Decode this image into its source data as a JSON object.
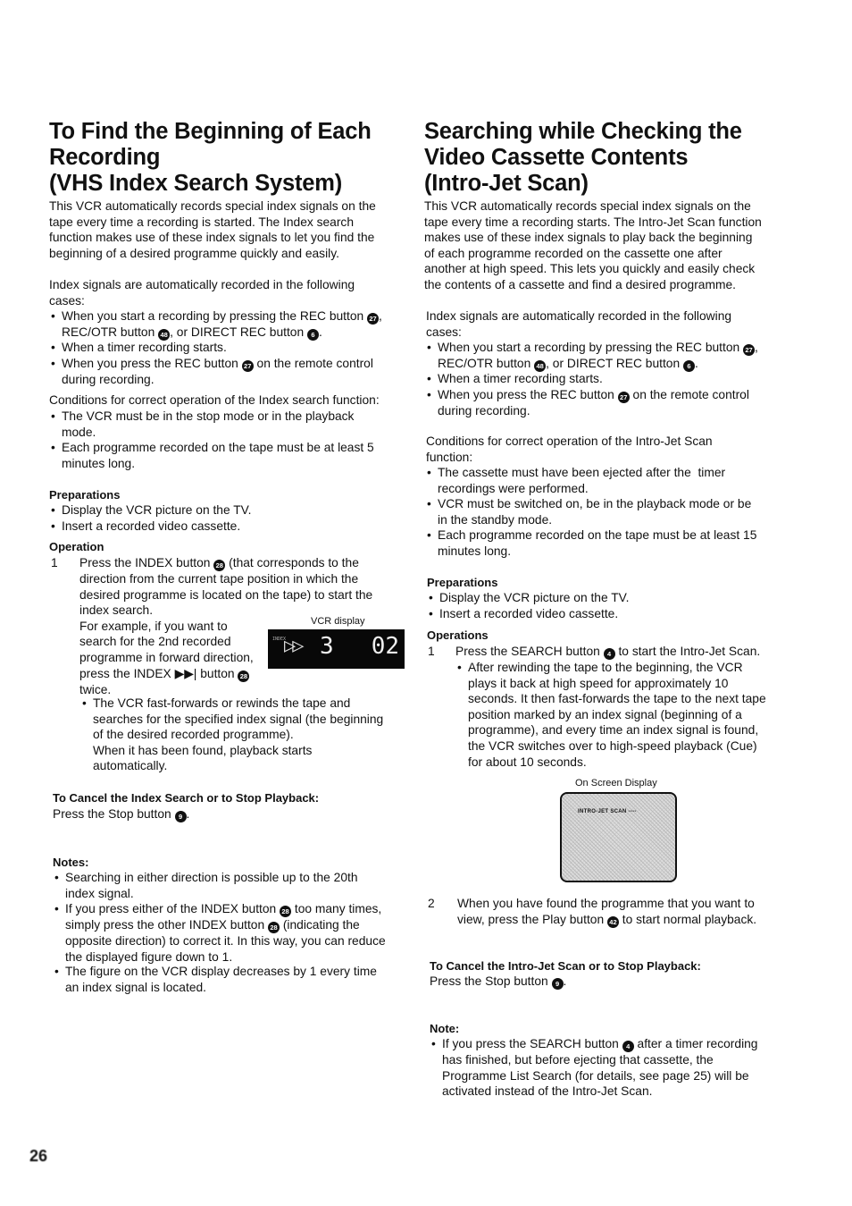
{
  "left": {
    "title": "To Find the Beginning of Each\nRecording\n(VHS Index Search System)",
    "intro": "This VCR automatically records special index signals on the\ntape every time a recording is started. The Index search\nfunction makes use of these index signals to let you find the\nbeginning of a desired programme quickly and easily.",
    "index_intro": "Index signals are automatically recorded in the following\ncases:",
    "index_cases": [
      "When you start a recording by pressing the REC button {27},\nREC/OTR button {48}, or DIRECT REC button {6}.",
      "When a timer recording starts.",
      "When you press the REC button {27} on the remote control\nduring recording."
    ],
    "conditions_intro": "Conditions for correct operation of the Index search function:",
    "conditions": [
      "The VCR must be in the stop mode or in the playback\nmode.",
      "Each programme recorded on the tape must be at least 5\nminutes long."
    ],
    "preparations_heading": "Preparations",
    "preparations": [
      "Display the VCR picture on the TV.",
      "Insert a recorded video cassette."
    ],
    "operation_heading": "Operation",
    "step1_num": "1",
    "step1_text": "Press the INDEX button {28} (that corresponds to the\ndirection from the current tape position in which the\ndesired programme is located on the tape) to start the\nindex search.\nFor example, if you want to\nsearch for the 2nd recorded\nprogramme in forward direction,\npress the INDEX ▶▶| button {28}\ntwice.",
    "vcr_display_label": "VCR display",
    "vcr_display": {
      "arrows": "▷▷",
      "left_digit": "3",
      "right_digits": "02",
      "tiny_label": "INDEX"
    },
    "step1_bullet": "The VCR fast-forwards or rewinds the tape and\nsearches for the specified index signal (the beginning\nof the desired recorded programme).\nWhen it has been found, playback starts\nautomatically.",
    "cancel_heading": "To Cancel the Index Search or to Stop Playback:",
    "cancel_text": "Press the Stop button {9}.",
    "notes_heading": "Notes:",
    "notes": [
      "Searching in either direction is possible up to the 20th\nindex signal.",
      "If you press either of the INDEX button {28} too many times,\nsimply press the other INDEX button {28} (indicating the\nopposite direction) to correct it. In this way, you can reduce\nthe displayed figure down to 1.",
      "The figure on the VCR display decreases by 1 every time\nan index signal is located."
    ]
  },
  "right": {
    "title": "Searching while Checking the\nVideo Cassette Contents\n(Intro-Jet Scan)",
    "intro": "This VCR automatically records special index signals on the\ntape every time a recording starts. The Intro-Jet Scan function\nmakes use of these index signals to play back the beginning\nof each programme recorded on the cassette one after\nanother at high speed. This lets you quickly and easily check\nthe contents of a cassette and find a desired programme.",
    "index_intro": "Index signals are automatically recorded in the following\ncases:",
    "index_cases": [
      "When you start a recording by pressing the REC button {27},\nREC/OTR button {48}, or DIRECT REC button {6}.",
      "When a timer recording starts.",
      "When you press the REC button {27} on the remote control\nduring recording."
    ],
    "conditions_intro": "Conditions for correct operation of the Intro-Jet Scan\nfunction:",
    "conditions": [
      "The cassette must have been ejected after the  timer\nrecordings were performed.",
      "VCR must be switched on, be in the playback mode or be\nin the standby mode.",
      "Each programme recorded on the tape must be at least 15\nminutes long."
    ],
    "preparations_heading": "Preparations",
    "preparations": [
      "Display the VCR picture on the TV.",
      "Insert a recorded video cassette."
    ],
    "operations_heading": "Operations",
    "step1_num": "1",
    "step1_text": "Press the SEARCH button {4} to start the Intro-Jet Scan.",
    "step1_bullet": "After rewinding the tape to the beginning, the VCR\nplays it back at high speed for approximately 10\nseconds. It then fast-forwards the tape to the next tape\nposition marked by an index signal (beginning of a\nprogramme), and every time an index signal is found,\nthe VCR switches over to high-speed playback (Cue)\nfor about 10 seconds.",
    "osd_label": "On Screen Display",
    "osd_text": "INTRO-JET SCAN  ----",
    "step2_num": "2",
    "step2_text": "When you have found the programme that you want to\nview, press the Play button {42} to start normal playback.",
    "cancel_heading": "To Cancel the Intro-Jet Scan or to Stop Playback:",
    "cancel_text": "Press the Stop button {9}.",
    "note_heading": "Note:",
    "notes": [
      "If you press the SEARCH button {4} after a timer recording\nhas finished, but before ejecting that cassette, the\nProgramme List Search (for details, see page 25) will be\nactivated instead of the Intro-Jet Scan."
    ]
  },
  "page_number": "26"
}
